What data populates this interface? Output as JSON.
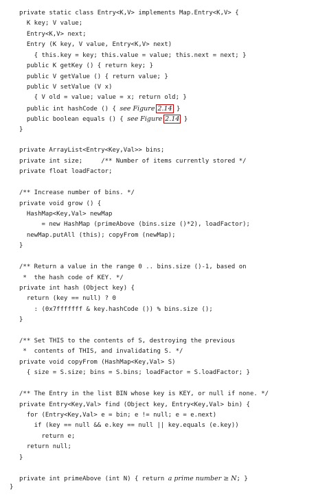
{
  "code_lines": [
    {
      "text": "private static class Entry<K,V> implements Map.Entry<K,V> {"
    },
    {
      "text": "  K key; V value;"
    },
    {
      "text": "  Entry<K,V> next;"
    },
    {
      "text": "  Entry (K key, V value, Entry<K,V> next)"
    },
    {
      "text": "    { this.key = key; this.value = value; this.next = next; }"
    },
    {
      "text": "  public K getKey () { return key; }"
    },
    {
      "text": "  public V getValue () { return value; }"
    },
    {
      "text": "  public V setValue (V x)"
    },
    {
      "text": "    { V old = value; value = x; return old; }"
    },
    {
      "pre": "  public int hashCode () { ",
      "italic": "see Figure ",
      "ref": "2.14",
      "post": " }"
    },
    {
      "pre": "  public boolean equals () { ",
      "italic": "see Figure ",
      "ref": "2.14",
      "post": " }"
    },
    {
      "text": "}"
    },
    {
      "text": ""
    },
    {
      "text": "private ArrayList<Entry<Key,Val>> bins;"
    },
    {
      "text": "private int size;     /** Number of items currently stored */"
    },
    {
      "text": "private float loadFactor;"
    },
    {
      "text": ""
    },
    {
      "text": "/** Increase number of bins. */"
    },
    {
      "text": "private void grow () {"
    },
    {
      "text": "  HashMap<Key,Val> newMap"
    },
    {
      "text": "      = new HashMap (primeAbove (bins.size ()*2), loadFactor);"
    },
    {
      "text": "  newMap.putAll (this); copyFrom (newMap);"
    },
    {
      "text": "}"
    },
    {
      "text": ""
    },
    {
      "text": "/** Return a value in the range 0 .. bins.size ()-1, based on"
    },
    {
      "text": " *  the hash code of KEY. */"
    },
    {
      "text": "private int hash (Object key) {"
    },
    {
      "text": "  return (key == null) ? 0"
    },
    {
      "text": "    : (0x7fffffff & key.hashCode ()) % bins.size ();"
    },
    {
      "text": "}"
    },
    {
      "text": ""
    },
    {
      "text": "/** Set THIS to the contents of S, destroying the previous"
    },
    {
      "text": " *  contents of THIS, and invalidating S. */"
    },
    {
      "text": "private void copyFrom (HashMap<Key,Val> S)"
    },
    {
      "text": "  { size = S.size; bins = S.bins; loadFactor = S.loadFactor; }"
    },
    {
      "text": ""
    },
    {
      "text": "/** The Entry in the list BIN whose key is KEY, or null if none. */"
    },
    {
      "text": "private Entry<Key,Val> find (Object key, Entry<Key,Val> bin) {"
    },
    {
      "text": "  for (Entry<Key,Val> e = bin; e != null; e = e.next)"
    },
    {
      "text": "    if (key == null && e.key == null || key.equals (e.key))"
    },
    {
      "text": "      return e;"
    },
    {
      "text": "  return null;"
    },
    {
      "text": "}"
    },
    {
      "text": ""
    },
    {
      "pre": "private int primeAbove (int N) { return ",
      "italic": "a prime number ≥ N",
      "post": "; }"
    }
  ],
  "closing_brace": "}"
}
